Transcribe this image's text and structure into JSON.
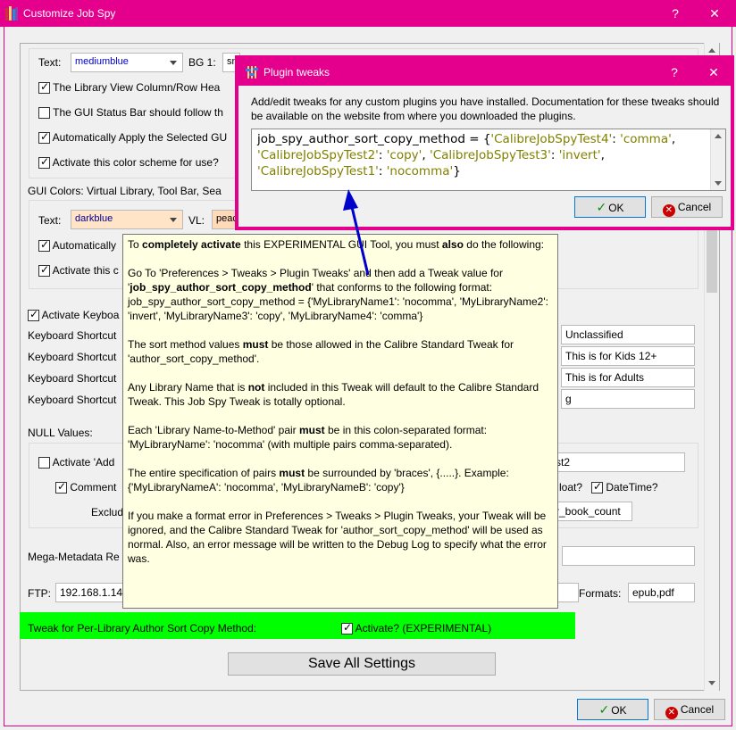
{
  "window": {
    "title": "Customize Job Spy",
    "help": "?",
    "close": "✕"
  },
  "top_group": {
    "text_label": "Text:",
    "text_color": "mediumblue",
    "bg1_label": "BG 1:",
    "bg1_value": "sn",
    "checks": [
      {
        "label": "The Library View Column/Row Hea",
        "checked": true
      },
      {
        "label": "The GUI Status Bar should follow th",
        "checked": false
      },
      {
        "label": "Automatically Apply the Selected GU",
        "checked": true
      },
      {
        "label": "Activate this color scheme for use?",
        "checked": true
      }
    ]
  },
  "gui_colors": {
    "heading": "GUI Colors: Virtual Library, Tool Bar, Sea",
    "text_label": "Text:",
    "text_color": "darkblue",
    "vl_label": "VL:",
    "vl_value": "peac",
    "checks": [
      {
        "label": "Automatically",
        "checked": true
      },
      {
        "label": "Activate this c",
        "checked": true
      }
    ]
  },
  "keyboard": {
    "activate_label": "Activate Keyboa",
    "rows": [
      {
        "label": "Keyboard Shortcut",
        "value": "Unclassified"
      },
      {
        "label": "Keyboard Shortcut",
        "value": "This is for Kids 12+"
      },
      {
        "label": "Keyboard Shortcut",
        "value": "This is for Adults"
      },
      {
        "label": "Keyboard Shortcut",
        "value": "g"
      }
    ]
  },
  "null_values": {
    "heading": "NULL Values:",
    "activate_label": "Activate 'Add",
    "test_value": "st2",
    "comment_label": "Comment",
    "float_label": "loat?",
    "datetime_label": "DateTime?",
    "exclude_label": "Exclud",
    "exclude_value": "r_book_count"
  },
  "mega_label": "Mega-Metadata Re",
  "ftp": {
    "label": "FTP:",
    "value": "192.168.1.14",
    "formats_label": "Formats:",
    "formats_value": "epub,pdf"
  },
  "green_row": {
    "label": "Tweak for Per-Library Author Sort Copy Method:",
    "activate_label": "Activate?  (EXPERIMENTAL)",
    "checked": true
  },
  "save_button": "Save All Settings",
  "ok_button": "OK",
  "cancel_button": "Cancel",
  "tooltip": {
    "p1_a": "To ",
    "p1_b": "completely activate",
    "p1_c": " this EXPERIMENTAL GUI Tool, you must ",
    "p1_d": "also",
    "p1_e": " do the following:",
    "p2_a": "Go To 'Preferences > Tweaks > Plugin Tweaks' and then add a Tweak value for '",
    "p2_b": "job_spy_author_sort_copy_method",
    "p2_c": "' that conforms to the following format: job_spy_author_sort_copy_method = {'MyLibraryName1': 'nocomma', 'MyLibraryName2': 'invert', 'MyLibraryName3': 'copy', 'MyLibraryName4': 'comma'}",
    "p3_a": "The sort method values ",
    "p3_b": "must",
    "p3_c": " be those allowed in the Calibre Standard Tweak for 'author_sort_copy_method'.",
    "p4_a": "Any Library Name that is ",
    "p4_b": "not",
    "p4_c": " included in this Tweak will default to the Calibre Standard Tweak. This Job Spy Tweak is totally optional.",
    "p5_a": "Each 'Library Name-to-Method' pair ",
    "p5_b": "must",
    "p5_c": " be in this colon-separated format: 'MyLibraryName': 'nocomma' (with multiple pairs comma-separated).",
    "p6_a": "The entire specification of pairs ",
    "p6_b": "must",
    "p6_c": " be surrounded by 'braces', {.....}. Example: {'MyLibraryNameA': 'nocomma', 'MyLibraryNameB': 'copy'}",
    "p7": "If you make a format error in Preferences > Tweaks > Plugin Tweaks, your Tweak will be ignored, and the Calibre Standard Tweak for 'author_sort_copy_method' will be used as normal. Also, an error message will be written to the Debug Log to specify what the error was."
  },
  "plugin_dialog": {
    "title": "Plugin tweaks",
    "help": "?",
    "close": "✕",
    "description": "Add/edit tweaks for any custom plugins you have installed. Documentation for these tweaks should be available on the website from where you downloaded the plugins.",
    "code": {
      "key": "job_spy_author_sort_copy_method = {",
      "k1": "'CalibreJobSpyTest4'",
      "v1": "'comma'",
      "k2": "'CalibreJobSpyTest2'",
      "v2": "'copy'",
      "k3": "'CalibreJobSpyTest3'",
      "v3": "'invert'",
      "k4": "'CalibreJobSpyTest1'",
      "v4": "'nocomma'"
    },
    "ok": "OK",
    "cancel": "Cancel"
  },
  "colors": {
    "accent": "#e4008c",
    "tooltip_bg": "#ffffe1",
    "green_bar": "#00ff00",
    "arrow": "#0000cd",
    "string_literal": "#808000"
  }
}
